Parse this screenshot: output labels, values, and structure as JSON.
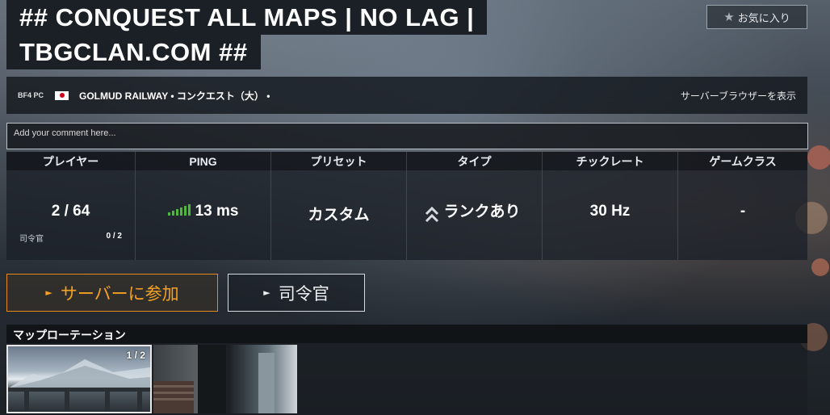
{
  "server": {
    "title_line1": "## CONQUEST ALL MAPS | NO LAG |",
    "title_line2": "TBGCLAN.COM ##",
    "favorite_label": "お気に入り",
    "platform": "BF4 PC",
    "map_mode": "GOLMUD RAILWAY • コンクエスト（大） •",
    "browse_label": "サーバーブラウザーを表示"
  },
  "comment": {
    "placeholder": "Add your comment here..."
  },
  "stats": {
    "headers": [
      "プレイヤー",
      "PING",
      "プリセット",
      "タイプ",
      "チックレート",
      "ゲームクラス"
    ],
    "players": "2 / 64",
    "commander_label": "司令官",
    "commander_value": "0 / 2",
    "ping": "13 ms",
    "ping_color": "#4fb83b",
    "preset": "カスタム",
    "type": "ランクあり",
    "tickrate": "30 Hz",
    "gameclass": "-"
  },
  "actions": {
    "join_label": "サーバーに参加",
    "commander_label": "司令官",
    "join_color": "#f5a223"
  },
  "rotation": {
    "title": "マップローテーション",
    "counter": "1 / 2"
  }
}
